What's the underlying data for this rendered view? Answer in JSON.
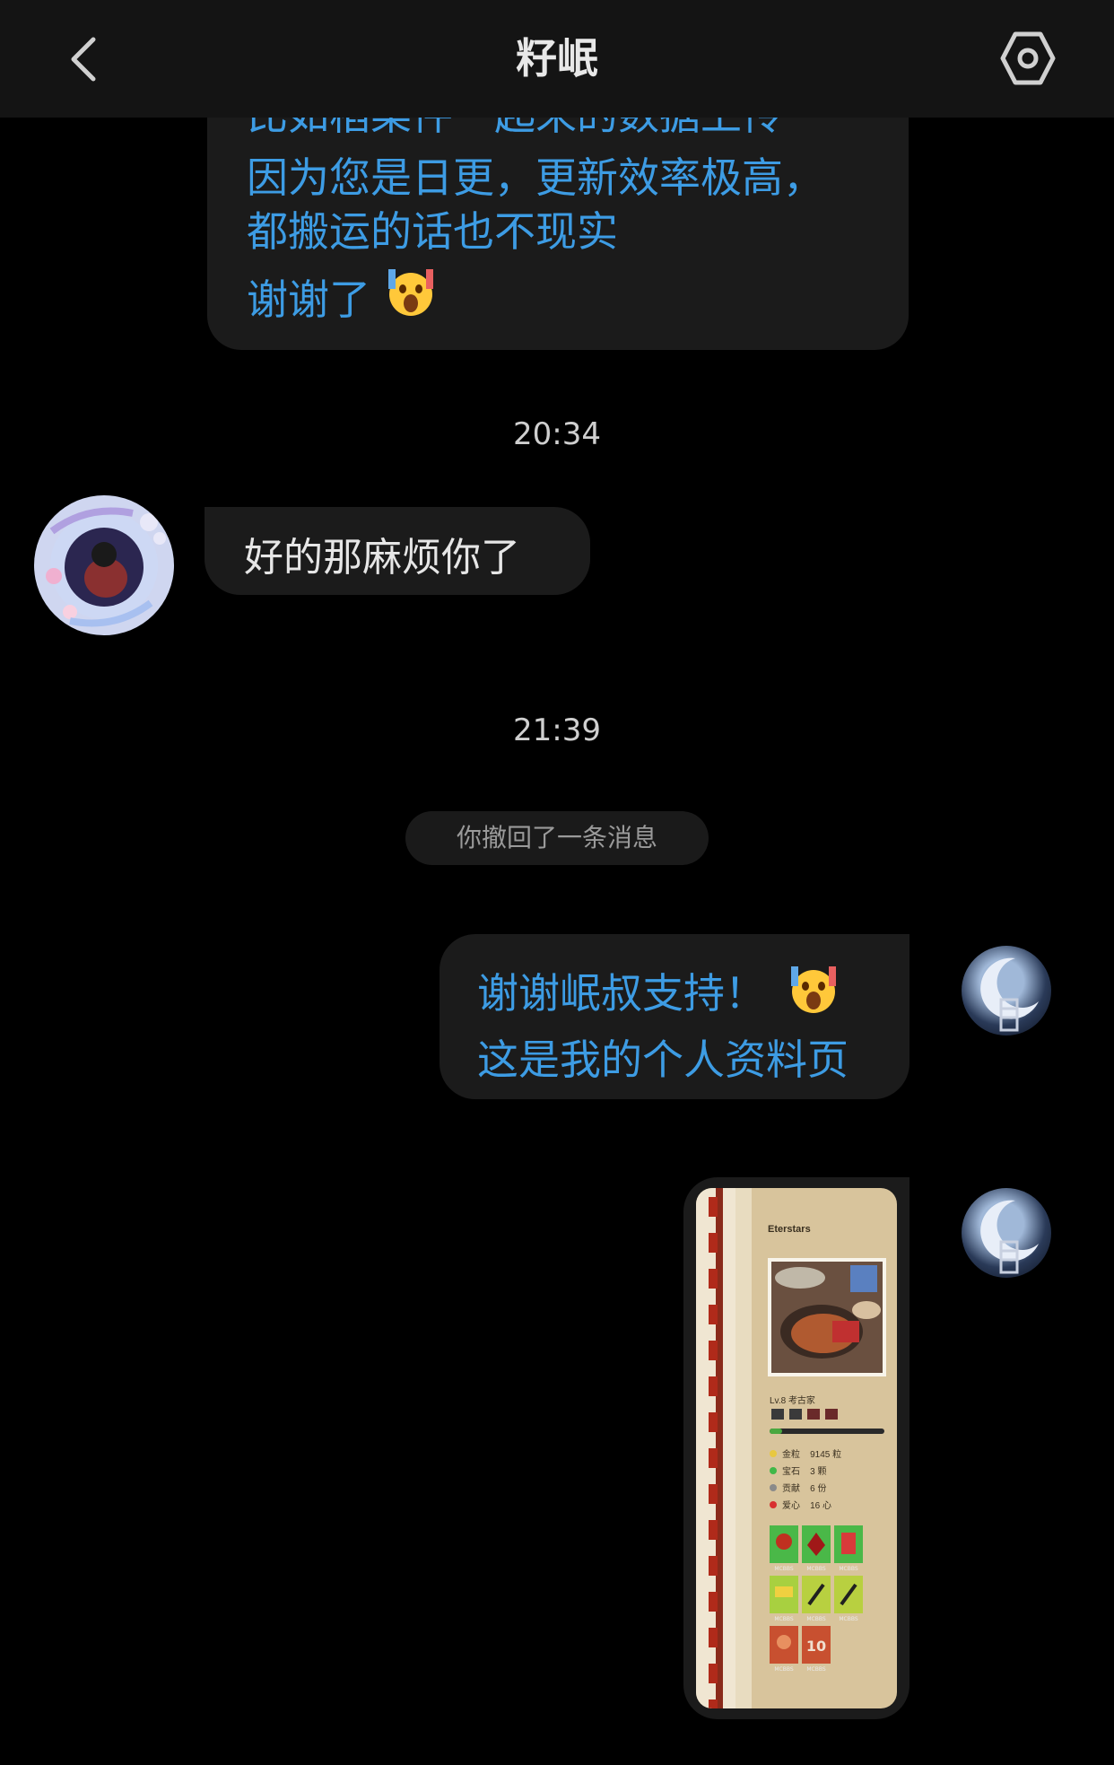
{
  "header": {
    "title": "籽岷",
    "back_icon": "chevron-left-icon",
    "settings_icon": "settings-gear-icon"
  },
  "messages": {
    "top_bubble": {
      "lines": [
        "比如稻菜件一起来的数据上传",
        "因为您是日更，更新效率极高，",
        "都搬运的话也不现实",
        "谢谢了"
      ],
      "emoji": "shocked-face-emoji"
    },
    "time_1": "20:34",
    "incoming": {
      "text": "好的那麻烦你了"
    },
    "time_2": "21:39",
    "recall_notice": "你撤回了一条消息",
    "outgoing": {
      "line_1": "谢谢岷叔支持！",
      "line_2": "这是我的个人资料页",
      "emoji": "shocked-face-emoji"
    },
    "image_message": {
      "username": "Eterstars",
      "level": "Lv.8 考古家",
      "stats": [
        {
          "label": "金粒",
          "value": "9145 粒"
        },
        {
          "label": "宝石",
          "value": "3 颗"
        },
        {
          "label": "贡献",
          "value": "6 份"
        },
        {
          "label": "爱心",
          "value": "16 心"
        }
      ],
      "badge_label": "MCBBS",
      "badge_number": "10"
    }
  },
  "colors": {
    "background": "#000000",
    "bubble": "#1b1b1b",
    "outgoing_text": "#3d9ce4",
    "incoming_text": "#e6e6e6"
  }
}
